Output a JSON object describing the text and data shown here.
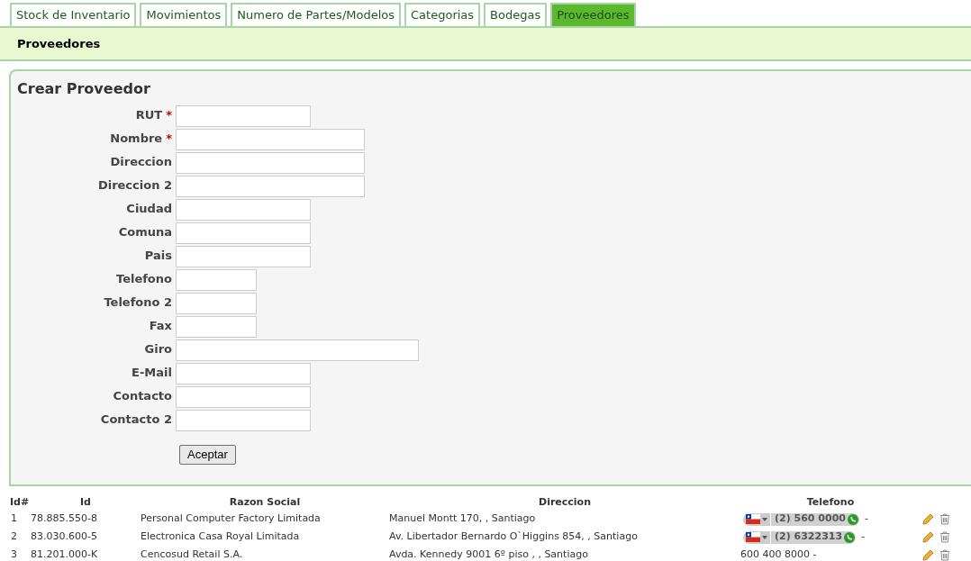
{
  "tabs": [
    {
      "label": "Stock de Inventario",
      "selected": false
    },
    {
      "label": "Movimientos",
      "selected": false
    },
    {
      "label": "Numero de Partes/Modelos",
      "selected": false
    },
    {
      "label": "Categorias",
      "selected": false
    },
    {
      "label": "Bodegas",
      "selected": false
    },
    {
      "label": "Proveedores",
      "selected": true
    }
  ],
  "section_title": "Proveedores",
  "form": {
    "title": "Crear Proveedor",
    "fields": [
      {
        "label": "RUT",
        "required": true,
        "kind": "medium"
      },
      {
        "label": "Nombre",
        "required": true,
        "kind": "long"
      },
      {
        "label": "Direccion",
        "required": false,
        "kind": "long"
      },
      {
        "label": "Direccion 2",
        "required": false,
        "kind": "long"
      },
      {
        "label": "Ciudad",
        "required": false,
        "kind": "medium"
      },
      {
        "label": "Comuna",
        "required": false,
        "kind": "medium"
      },
      {
        "label": "Pais",
        "required": false,
        "kind": "medium"
      },
      {
        "label": "Telefono",
        "required": false,
        "kind": "short"
      },
      {
        "label": "Telefono 2",
        "required": false,
        "kind": "short"
      },
      {
        "label": "Fax",
        "required": false,
        "kind": "short"
      },
      {
        "label": "Giro",
        "required": false,
        "kind": "wide"
      },
      {
        "label": "E-Mail",
        "required": false,
        "kind": "medium"
      },
      {
        "label": "Contacto",
        "required": false,
        "kind": "medium"
      },
      {
        "label": "Contacto 2",
        "required": false,
        "kind": "medium"
      }
    ],
    "required_mark": "*",
    "submit": "Aceptar"
  },
  "table": {
    "columns": [
      "Id#",
      "Id",
      "Razon Social",
      "Direccion",
      "Telefono"
    ],
    "rows": [
      {
        "num": "1",
        "id": "78.885.550-8",
        "razon_social": "Personal Computer Factory Limitada",
        "direccion": "Manuel Montt 170, , Santiago",
        "telefono": "(2) 560 0000",
        "telefono_2": "-",
        "kind": "flag"
      },
      {
        "num": "2",
        "id": "83.030.600-5",
        "razon_social": "Electronica Casa Royal Limitada",
        "direccion": "Av. Libertador Bernardo O`Higgins 854, , Santiago",
        "telefono": "(2) 6322313",
        "telefono_2": "-",
        "kind": "flag"
      },
      {
        "num": "3",
        "id": "81.201.000-K",
        "razon_social": "Cencosud Retail S.A.",
        "direccion": "Avda. Kennedy 9001 6º piso , , Santiago",
        "telefono": "600 400 8000 -",
        "kind": "plain"
      }
    ]
  }
}
